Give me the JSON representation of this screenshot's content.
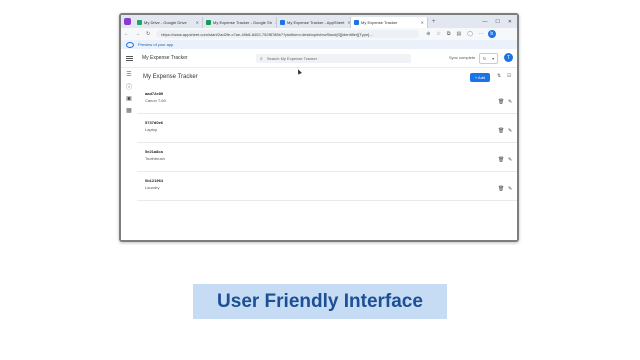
{
  "browser": {
    "tabs": [
      {
        "label": "My Drive - Google Drive",
        "icon": "google-drive-icon",
        "color": "#1fa463"
      },
      {
        "label": "My Expense Tracker - Google Sh",
        "icon": "google-sheets-icon",
        "color": "#0f9d58"
      },
      {
        "label": "My Expense Tracker - AppSheet",
        "icon": "appsheet-icon",
        "color": "#1a73e8"
      },
      {
        "label": "My Expense Tracker",
        "icon": "appsheet-icon",
        "color": "#1a73e8",
        "active": true
      }
    ],
    "url": "https://www.appsheet.com/start/2ad2fe-c7ae-40b8-8402-752f8785b7?platform=desktop#vIewStack[0][identifier][Type]..."
  },
  "preview_banner": "Preview of your app",
  "app": {
    "title": "My Expense Tracker",
    "search_placeholder": "Search My Expense Tracker",
    "sync_status": "Sync complete",
    "avatar_initial": "T"
  },
  "view": {
    "title": "My Expense Tracker",
    "add_label": "+ Add"
  },
  "records": [
    {
      "id": "aad72e89",
      "description": "Canon T-60"
    },
    {
      "id": "5737d0e6",
      "description": "Laptop"
    },
    {
      "id": "5e21a8ca",
      "description": "Toothbrush"
    },
    {
      "id": "0b121964",
      "description": "Laundry"
    }
  ],
  "caption": "User Friendly Interface",
  "colors": {
    "accent": "#1a73e8",
    "caption_bg": "#c6dcf5",
    "caption_text": "#1c4f93",
    "frame": "#7d7d7d"
  }
}
